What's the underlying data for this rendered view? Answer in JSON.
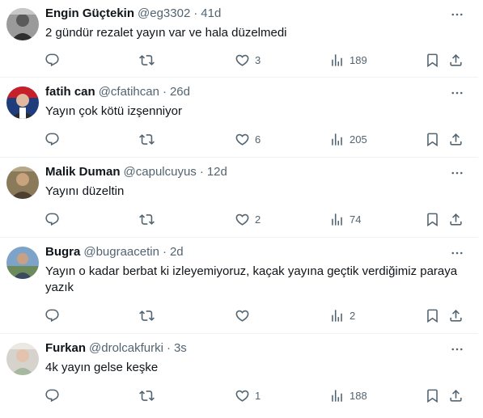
{
  "tweets": [
    {
      "name": "Engin Güçtekin",
      "handle": "@eg3302",
      "sep": "·",
      "time": "41d",
      "text": "2 gündür rezalet yayın var ve hala düzelmedi",
      "replies": "",
      "retweets": "",
      "likes": "3",
      "views": "189"
    },
    {
      "name": "fatih can",
      "handle": "@cfatihcan",
      "sep": "·",
      "time": "26d",
      "text": "Yayın çok kötü izşenniyor",
      "replies": "",
      "retweets": "",
      "likes": "6",
      "views": "205"
    },
    {
      "name": "Malik Duman",
      "handle": "@capulcuyus",
      "sep": "·",
      "time": "12d",
      "text": "Yayını düzeltin",
      "replies": "",
      "retweets": "",
      "likes": "2",
      "views": "74"
    },
    {
      "name": "Bugra",
      "handle": "@bugraacetin",
      "sep": "·",
      "time": "2d",
      "text": "Yayın o kadar berbat ki izleyemiyoruz, kaçak yayına geçtik verdiğimiz paraya yazık",
      "replies": "",
      "retweets": "",
      "likes": "",
      "views": "2"
    },
    {
      "name": "Furkan",
      "handle": "@drolcakfurki",
      "sep": "·",
      "time": "3s",
      "text": "4k  yayın gelse keşke",
      "replies": "",
      "retweets": "",
      "likes": "1",
      "views": "188"
    }
  ],
  "icons": {
    "reply": "reply-icon",
    "retweet": "retweet-icon",
    "like": "heart-icon",
    "views": "views-icon",
    "bookmark": "bookmark-icon",
    "share": "share-icon",
    "more": "more-options-icon"
  },
  "colors": {
    "text": "#0f1419",
    "secondary": "#536471",
    "divider": "#eff3f4"
  }
}
